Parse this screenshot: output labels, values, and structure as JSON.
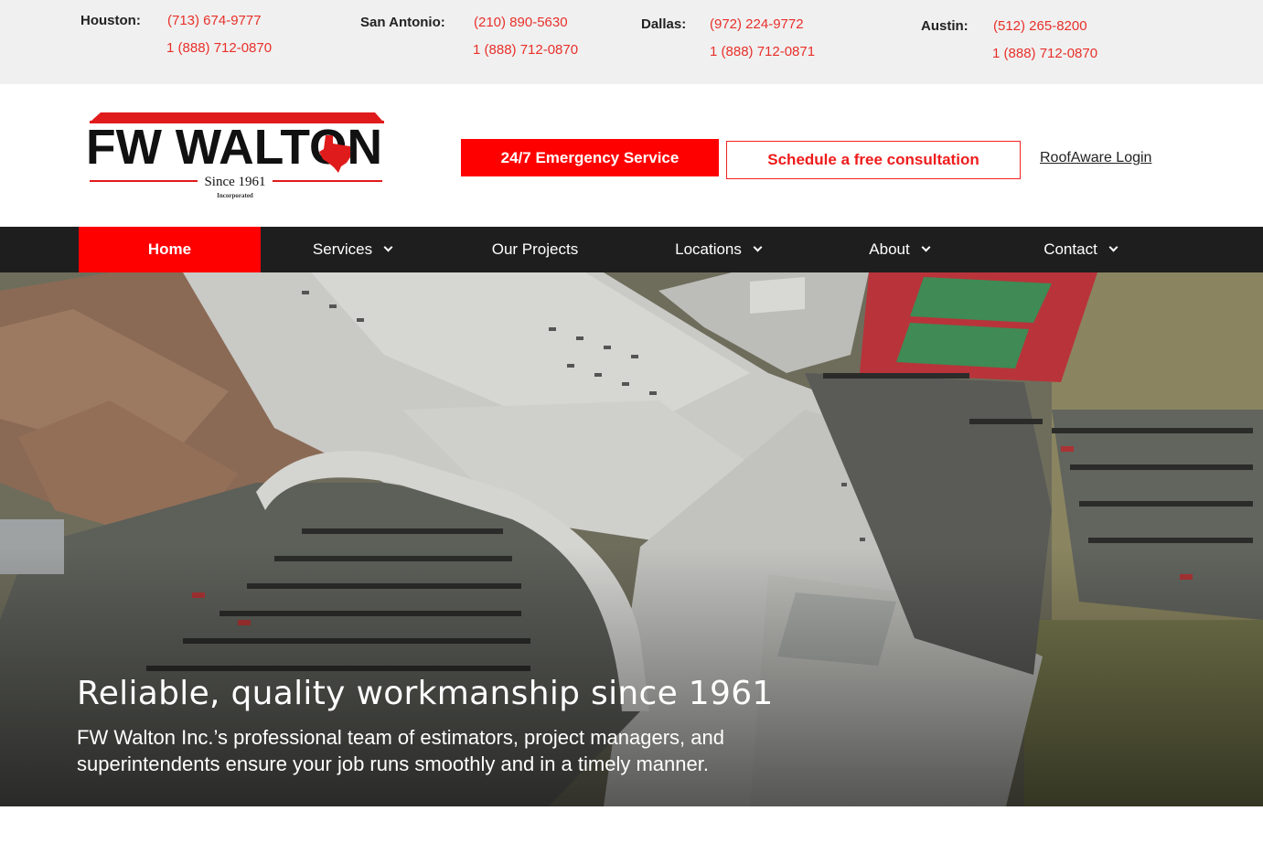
{
  "locations": [
    {
      "city": "Houston:",
      "phone_local": "(713) 674-9777",
      "phone_toll": "1 (888) 712-0870"
    },
    {
      "city": "San Antonio:",
      "phone_local": "(210) 890-5630",
      "phone_toll": "1 (888) 712-0870"
    },
    {
      "city": "Dallas:",
      "phone_local": "(972) 224-9772",
      "phone_toll": "1 (888) 712-0871"
    },
    {
      "city": "Austin:",
      "phone_local": "(512) 265-8200",
      "phone_toll": "1 (888) 712-0870"
    }
  ],
  "logo": {
    "name": "FW WALTON",
    "since": "Since 1961",
    "incorporated": "Incorporated"
  },
  "header": {
    "emergency_label": "24/7 Emergency Service",
    "consult_label": "Schedule a free consultation",
    "login_label": "RoofAware Login"
  },
  "nav": {
    "items": [
      {
        "label": "Home",
        "has_dropdown": false,
        "active": true
      },
      {
        "label": "Services",
        "has_dropdown": true
      },
      {
        "label": "Our Projects",
        "has_dropdown": false
      },
      {
        "label": "Locations",
        "has_dropdown": true
      },
      {
        "label": "About",
        "has_dropdown": true
      },
      {
        "label": "Contact",
        "has_dropdown": true
      }
    ]
  },
  "hero": {
    "title": "Reliable, quality workmanship since 1961",
    "text": "FW Walton Inc.’s professional team of estimators, project managers, and superintendents ensure your job runs smoothly and in a timely manner."
  },
  "colors": {
    "brand_red": "#ff0000",
    "nav_bg": "#1e1e1e",
    "topbar_bg": "#f0f0f0",
    "phone_red": "#e8302a"
  }
}
